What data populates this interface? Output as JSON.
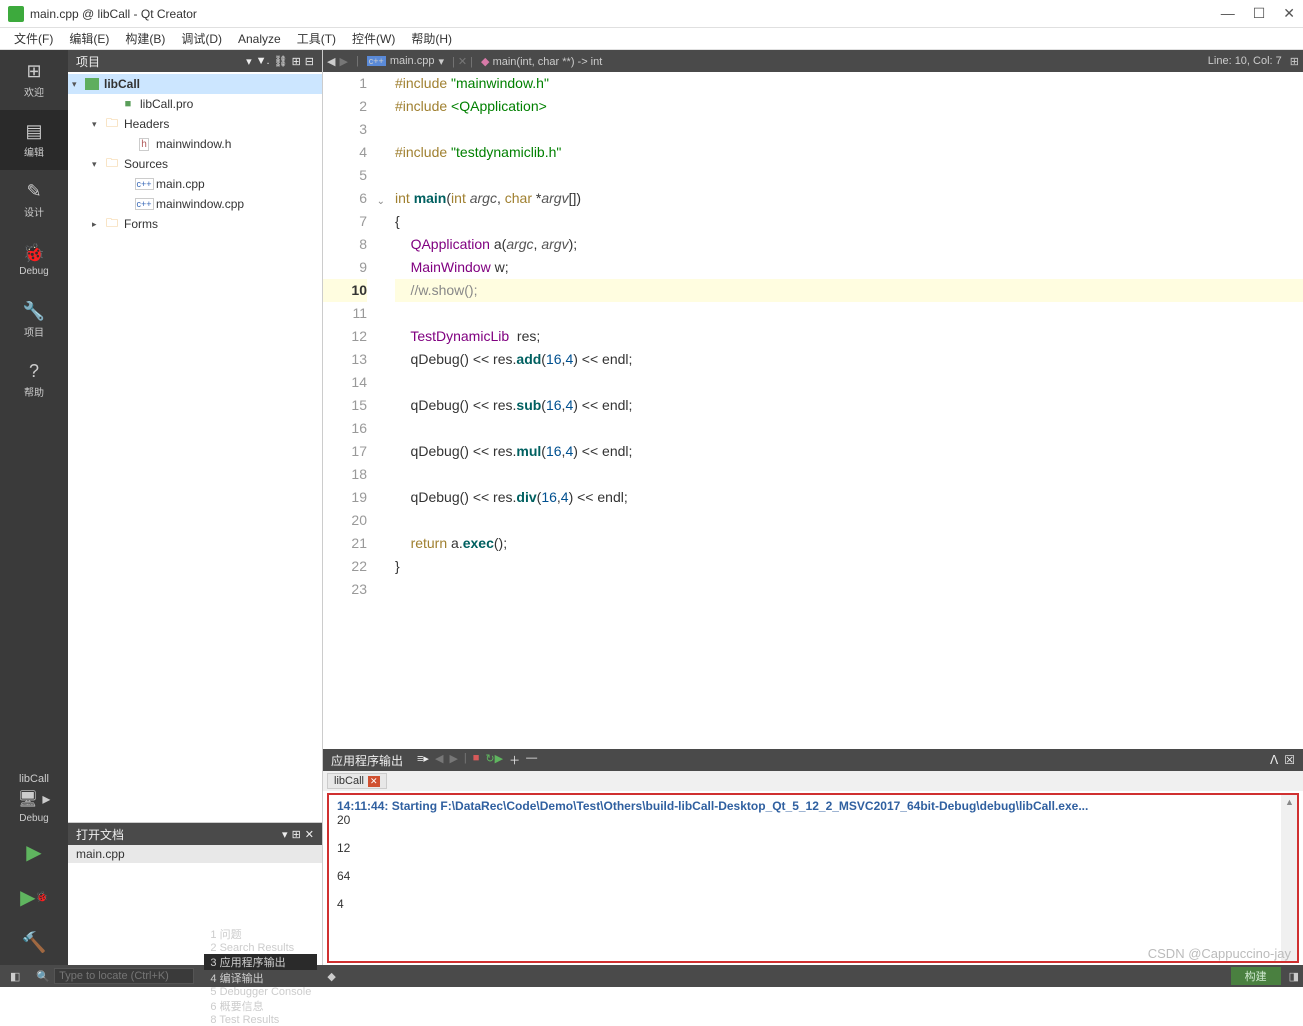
{
  "window": {
    "title": "main.cpp @ libCall - Qt Creator"
  },
  "menubar": [
    "文件(F)",
    "编辑(E)",
    "构建(B)",
    "调试(D)",
    "Analyze",
    "工具(T)",
    "控件(W)",
    "帮助(H)"
  ],
  "left_rail": {
    "items": [
      {
        "icon": "⊞",
        "label": "欢迎"
      },
      {
        "icon": "▤",
        "label": "编辑"
      },
      {
        "icon": "✎",
        "label": "设计"
      },
      {
        "icon": "🐞",
        "label": "Debug"
      },
      {
        "icon": "🔧",
        "label": "项目"
      },
      {
        "icon": "?",
        "label": "帮助"
      }
    ],
    "project": "libCall",
    "config": "Debug"
  },
  "side": {
    "header": "项目",
    "tree": {
      "root": "libCall",
      "items": [
        {
          "label": "libCall.pro",
          "type": "pro",
          "indent": 2
        },
        {
          "label": "Headers",
          "type": "folder",
          "indent": 1,
          "arrow": "▾"
        },
        {
          "label": "mainwindow.h",
          "type": "h",
          "indent": 3
        },
        {
          "label": "Sources",
          "type": "folder",
          "indent": 1,
          "arrow": "▾"
        },
        {
          "label": "main.cpp",
          "type": "cpp",
          "indent": 3
        },
        {
          "label": "mainwindow.cpp",
          "type": "cpp",
          "indent": 3
        },
        {
          "label": "Forms",
          "type": "folder",
          "indent": 1,
          "arrow": "▸"
        }
      ]
    },
    "open_docs_header": "打开文档",
    "open_docs": [
      "main.cpp"
    ]
  },
  "editor": {
    "toolbar_file": "main.cpp",
    "symbol": "main(int, char **) -> int",
    "cursor": "Line: 10, Col: 7",
    "lines": 23,
    "current_line": 10
  },
  "code": [
    {
      "raw": "#include \"mainwindow.h\"",
      "tokens": [
        [
          "#include ",
          "keyword"
        ],
        [
          "\"mainwindow.h\"",
          "string"
        ]
      ]
    },
    {
      "raw": "#include <QApplication>",
      "tokens": [
        [
          "#include ",
          "keyword"
        ],
        [
          "<QApplication>",
          "string"
        ]
      ]
    },
    {
      "raw": "",
      "tokens": []
    },
    {
      "raw": "#include \"testdynamiclib.h\"",
      "tokens": [
        [
          "#include ",
          "keyword"
        ],
        [
          "\"testdynamiclib.h\"",
          "string"
        ]
      ]
    },
    {
      "raw": "",
      "tokens": []
    },
    {
      "raw": "int main(int argc, char *argv[])",
      "tokens": [
        [
          "int ",
          "keyword"
        ],
        [
          "main",
          "func"
        ],
        [
          "(",
          "op"
        ],
        [
          "int ",
          "keyword"
        ],
        [
          "argc",
          "param"
        ],
        [
          ", ",
          "op"
        ],
        [
          "char ",
          "keyword"
        ],
        [
          "*",
          "op"
        ],
        [
          "argv",
          "param"
        ],
        [
          "[])",
          "op"
        ]
      ]
    },
    {
      "raw": "{",
      "tokens": [
        [
          "{",
          "op"
        ]
      ]
    },
    {
      "raw": "    QApplication a(argc, argv);",
      "tokens": [
        [
          "    ",
          "op"
        ],
        [
          "QApplication ",
          "type"
        ],
        [
          "a",
          "op"
        ],
        [
          "(",
          "op"
        ],
        [
          "argc",
          "param"
        ],
        [
          ", ",
          "op"
        ],
        [
          "argv",
          "param"
        ],
        [
          ");",
          "op"
        ]
      ]
    },
    {
      "raw": "    MainWindow w;",
      "tokens": [
        [
          "    ",
          "op"
        ],
        [
          "MainWindow ",
          "type"
        ],
        [
          "w;",
          "op"
        ]
      ]
    },
    {
      "raw": "    //w.show();",
      "tokens": [
        [
          "    //w.show();",
          "comment"
        ]
      ]
    },
    {
      "raw": "",
      "tokens": []
    },
    {
      "raw": "    TestDynamicLib  res;",
      "tokens": [
        [
          "    ",
          "op"
        ],
        [
          "TestDynamicLib  ",
          "type"
        ],
        [
          "res;",
          "op"
        ]
      ]
    },
    {
      "raw": "    qDebug() << res.add(16,4) << endl;",
      "tokens": [
        [
          "    qDebug() << res.",
          "op"
        ],
        [
          "add",
          "func"
        ],
        [
          "(",
          "op"
        ],
        [
          "16",
          "number"
        ],
        [
          ",",
          "op"
        ],
        [
          "4",
          "number"
        ],
        [
          ") << endl;",
          "op"
        ]
      ]
    },
    {
      "raw": "",
      "tokens": []
    },
    {
      "raw": "    qDebug() << res.sub(16,4) << endl;",
      "tokens": [
        [
          "    qDebug() << res.",
          "op"
        ],
        [
          "sub",
          "func"
        ],
        [
          "(",
          "op"
        ],
        [
          "16",
          "number"
        ],
        [
          ",",
          "op"
        ],
        [
          "4",
          "number"
        ],
        [
          ") << endl;",
          "op"
        ]
      ]
    },
    {
      "raw": "",
      "tokens": []
    },
    {
      "raw": "    qDebug() << res.mul(16,4) << endl;",
      "tokens": [
        [
          "    qDebug() << res.",
          "op"
        ],
        [
          "mul",
          "func"
        ],
        [
          "(",
          "op"
        ],
        [
          "16",
          "number"
        ],
        [
          ",",
          "op"
        ],
        [
          "4",
          "number"
        ],
        [
          ") << endl;",
          "op"
        ]
      ]
    },
    {
      "raw": "",
      "tokens": []
    },
    {
      "raw": "    qDebug() << res.div(16,4) << endl;",
      "tokens": [
        [
          "    qDebug() << res.",
          "op"
        ],
        [
          "div",
          "func"
        ],
        [
          "(",
          "op"
        ],
        [
          "16",
          "number"
        ],
        [
          ",",
          "op"
        ],
        [
          "4",
          "number"
        ],
        [
          ") << endl;",
          "op"
        ]
      ]
    },
    {
      "raw": "",
      "tokens": []
    },
    {
      "raw": "    return a.exec();",
      "tokens": [
        [
          "    ",
          "op"
        ],
        [
          "return ",
          "keyword"
        ],
        [
          "a.",
          "op"
        ],
        [
          "exec",
          "func"
        ],
        [
          "();",
          "op"
        ]
      ]
    },
    {
      "raw": "}",
      "tokens": [
        [
          "}",
          "op"
        ]
      ]
    },
    {
      "raw": "",
      "tokens": []
    }
  ],
  "output": {
    "header": "应用程序输出",
    "tab": "libCall",
    "ts": "14:11:44:",
    "msg_prefix": " Starting ",
    "path": "F:\\DataRec\\Code\\Demo\\Test\\Others\\build-libCall-Desktop_Qt_5_12_2_MSVC2017_64bit-Debug\\debug\\libCall.exe",
    "msg_suffix": "...",
    "results": [
      "20",
      "",
      "12",
      "",
      "64",
      "",
      "4"
    ]
  },
  "statusbar": {
    "search_placeholder": "Type to locate (Ctrl+K)",
    "panes": [
      "1  问题",
      "2  Search Results",
      "3  应用程序输出",
      "4  编译输出",
      "5  Debugger Console",
      "6  概要信息",
      "8  Test Results"
    ],
    "build": "构建"
  },
  "watermark": "CSDN @Cappuccino-jay"
}
